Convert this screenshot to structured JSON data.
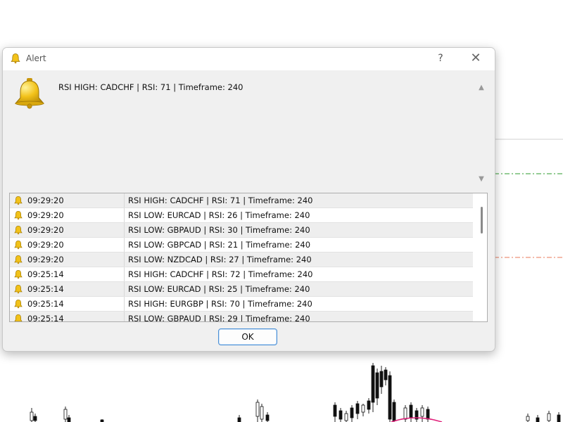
{
  "window": {
    "title": "Alert",
    "help_label": "?",
    "close_label": "✕",
    "icon": "bell-icon"
  },
  "message": {
    "icon": "bell-icon",
    "text": "RSI HIGH: CADCHF | RSI: 71 | Timeframe: 240"
  },
  "history": {
    "rows": [
      {
        "time": "09:29:20",
        "message": "RSI HIGH: CADCHF | RSI: 71 | Timeframe: 240"
      },
      {
        "time": "09:29:20",
        "message": "RSI LOW: EURCAD | RSI: 26 | Timeframe: 240"
      },
      {
        "time": "09:29:20",
        "message": "RSI LOW: GBPAUD | RSI: 30 | Timeframe: 240"
      },
      {
        "time": "09:29:20",
        "message": "RSI LOW: GBPCAD | RSI: 21 | Timeframe: 240"
      },
      {
        "time": "09:29:20",
        "message": "RSI LOW: NZDCAD | RSI: 27 | Timeframe: 240"
      },
      {
        "time": "09:25:14",
        "message": "RSI HIGH: CADCHF | RSI: 72 | Timeframe: 240"
      },
      {
        "time": "09:25:14",
        "message": "RSI LOW: EURCAD | RSI: 25 | Timeframe: 240"
      },
      {
        "time": "09:25:14",
        "message": "RSI HIGH: EURGBP | RSI: 70 | Timeframe: 240"
      },
      {
        "time": "09:25:14",
        "message": "RSI LOW: GBPAUD | RSI: 29 | Timeframe: 240"
      }
    ]
  },
  "buttons": {
    "ok_label": "OK"
  },
  "colors": {
    "bell_gold": "#e8b810",
    "level_high": "#2e9b2e",
    "level_low": "#e8785a",
    "highlight_circle": "#e0207a"
  }
}
